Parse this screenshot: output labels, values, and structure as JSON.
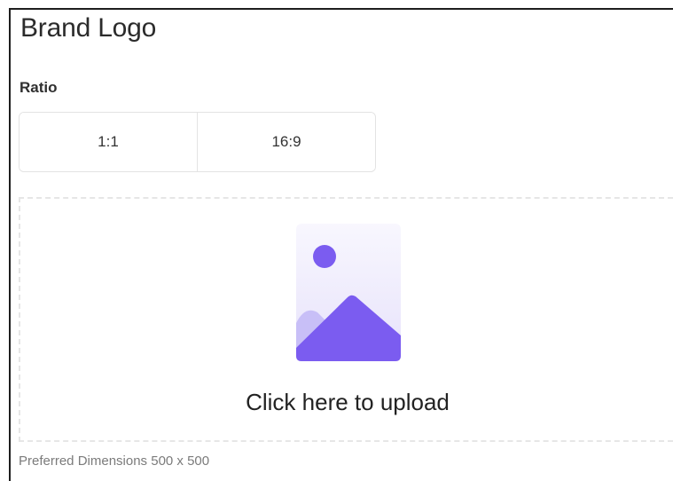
{
  "section": {
    "title": "Brand Logo"
  },
  "ratio": {
    "label": "Ratio",
    "options": [
      "1:1",
      "16:9"
    ]
  },
  "upload": {
    "icon": "image-placeholder-icon",
    "cta": "Click here to upload"
  },
  "hint": "Preferred Dimensions 500 x 500",
  "colors": {
    "accent": "#7b5cf0",
    "accent_light": "#c8bff7",
    "icon_bg_top": "#f7f6fd",
    "icon_bg_bottom": "#e9e5fb",
    "border": "#e3e3e3"
  }
}
